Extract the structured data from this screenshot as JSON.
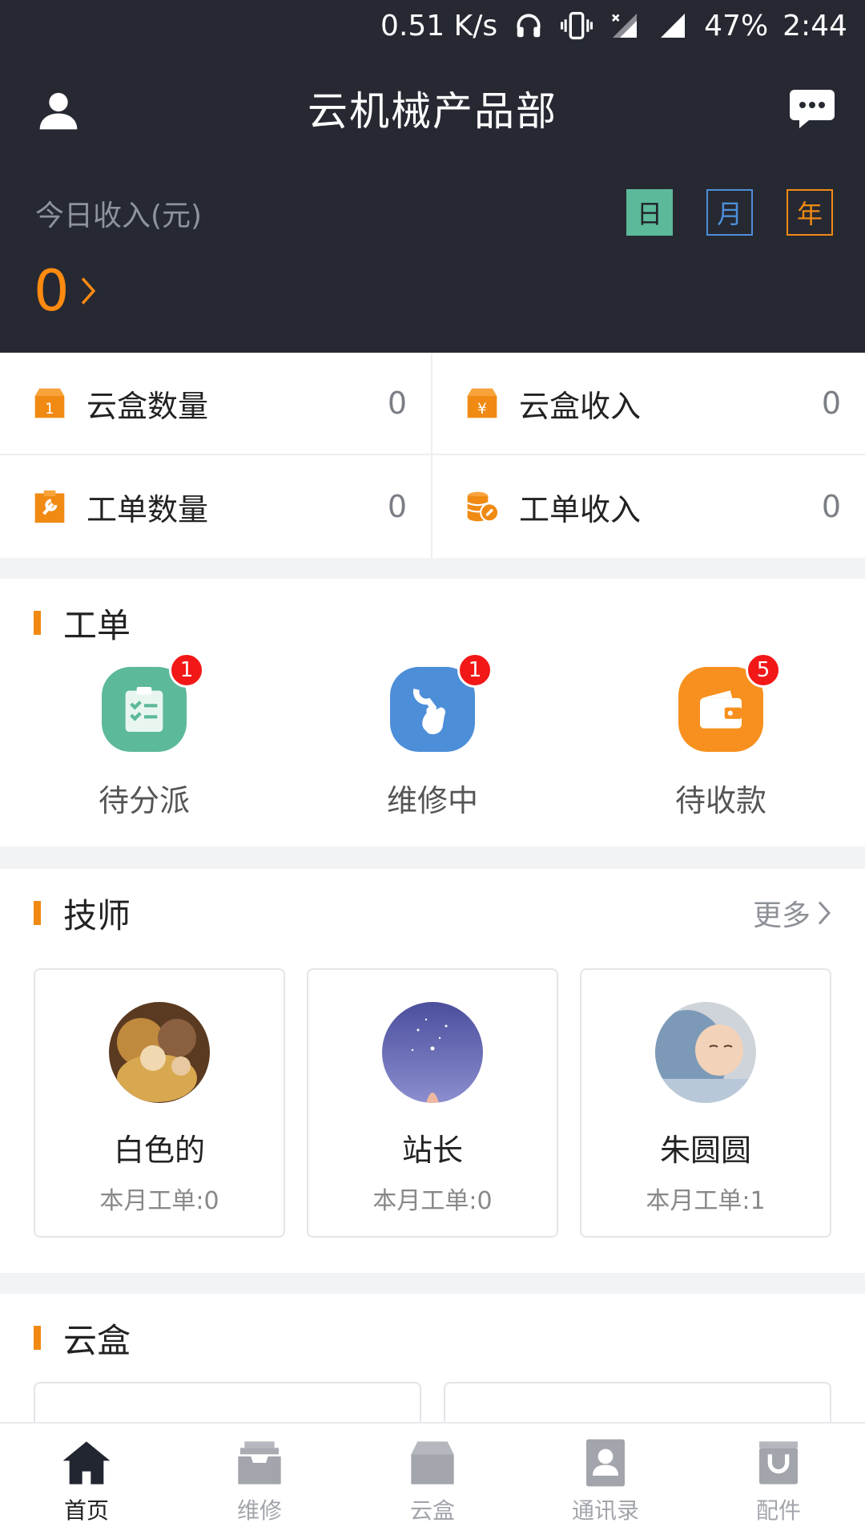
{
  "status_bar": {
    "speed": "0.51 K/s",
    "battery": "47%",
    "time": "2:44"
  },
  "header": {
    "title": "云机械产品部"
  },
  "income": {
    "label": "今日收入(元)",
    "value": "0",
    "periods": {
      "day": "日",
      "month": "月",
      "year": "年"
    }
  },
  "stats": [
    {
      "label": "云盒数量",
      "value": "0"
    },
    {
      "label": "云盒收入",
      "value": "0"
    },
    {
      "label": "工单数量",
      "value": "0"
    },
    {
      "label": "工单收入",
      "value": "0"
    }
  ],
  "orders_section": {
    "title": "工单",
    "items": [
      {
        "label": "待分派",
        "badge": "1"
      },
      {
        "label": "维修中",
        "badge": "1"
      },
      {
        "label": "待收款",
        "badge": "5"
      }
    ]
  },
  "techs_section": {
    "title": "技师",
    "more": "更多",
    "items": [
      {
        "name": "白色的",
        "count": "本月工单:0"
      },
      {
        "name": "站长",
        "count": "本月工单:0"
      },
      {
        "name": "朱圆圆",
        "count": "本月工单:1"
      }
    ]
  },
  "cloud_section": {
    "title": "云盒"
  },
  "bottom_nav": [
    {
      "label": "首页"
    },
    {
      "label": "维修"
    },
    {
      "label": "云盒"
    },
    {
      "label": "通讯录"
    },
    {
      "label": "配件"
    }
  ],
  "colors": {
    "accent": "#f08a13",
    "header_bg": "#262932",
    "green": "#5cb99a",
    "blue": "#4d8ed9",
    "badge": "#f21818"
  }
}
